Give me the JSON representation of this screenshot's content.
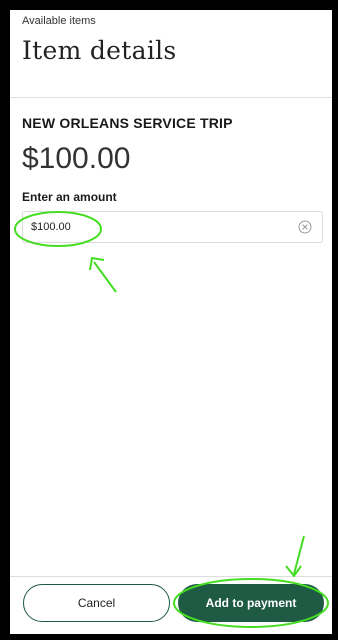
{
  "header": {
    "breadcrumb": "Available items",
    "title": "Item details"
  },
  "item": {
    "name": "NEW ORLEANS SERVICE TRIP",
    "price": "$100.00"
  },
  "amount": {
    "label": "Enter an amount",
    "value": "$100.00",
    "clear_icon": "circle-x-icon"
  },
  "footer": {
    "cancel_label": "Cancel",
    "add_label": "Add to payment"
  },
  "colors": {
    "accent": "#1f5a44",
    "annotation": "#44dd22"
  }
}
